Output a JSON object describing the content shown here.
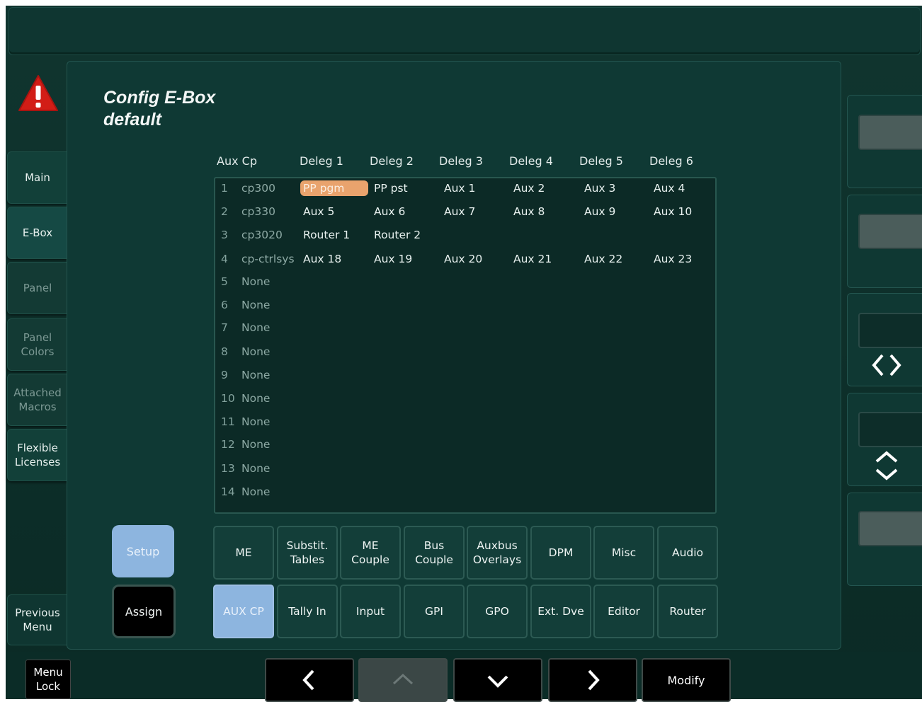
{
  "window": {
    "title_line1": "Config E-Box",
    "title_line2": "default"
  },
  "left_tabs": [
    {
      "label": "Main",
      "state": "normal"
    },
    {
      "label": "E-Box",
      "state": "active"
    },
    {
      "label": "Panel",
      "state": "dim"
    },
    {
      "label": "Panel\nColors",
      "state": "dim"
    },
    {
      "label": "Attached\nMacros",
      "state": "dim"
    },
    {
      "label": "Flexible\nLicenses",
      "state": "normal"
    }
  ],
  "previous_menu": "Previous\nMenu",
  "menu_lock": "Menu\nLock",
  "table": {
    "headers": [
      "Aux Cp",
      "Deleg 1",
      "Deleg 2",
      "Deleg 3",
      "Deleg 4",
      "Deleg 5",
      "Deleg 6"
    ],
    "rows": [
      {
        "num": "1",
        "cp": "cp300",
        "d": [
          "PP pgm",
          "PP pst",
          "Aux 1",
          "Aux 2",
          "Aux 3",
          "Aux 4"
        ]
      },
      {
        "num": "2",
        "cp": "cp330",
        "d": [
          "Aux 5",
          "Aux 6",
          "Aux 7",
          "Aux 8",
          "Aux 9",
          "Aux 10"
        ]
      },
      {
        "num": "3",
        "cp": "cp3020",
        "d": [
          "Router 1",
          "Router 2",
          "",
          "",
          "",
          ""
        ]
      },
      {
        "num": "4",
        "cp": "cp-ctrlsys",
        "d": [
          "Aux 18",
          "Aux 19",
          "Aux 20",
          "Aux 21",
          "Aux 22",
          "Aux 23"
        ]
      },
      {
        "num": "5",
        "cp": "None",
        "d": []
      },
      {
        "num": "6",
        "cp": "None",
        "d": []
      },
      {
        "num": "7",
        "cp": "None",
        "d": []
      },
      {
        "num": "8",
        "cp": "None",
        "d": []
      },
      {
        "num": "9",
        "cp": "None",
        "d": []
      },
      {
        "num": "10",
        "cp": "None",
        "d": []
      },
      {
        "num": "11",
        "cp": "None",
        "d": []
      },
      {
        "num": "12",
        "cp": "None",
        "d": []
      },
      {
        "num": "13",
        "cp": "None",
        "d": []
      },
      {
        "num": "14",
        "cp": "None",
        "d": []
      }
    ],
    "selected_cell": "PP pgm",
    "selected_color": "#e9a36d"
  },
  "mode_buttons": {
    "setup": "Setup",
    "assign": "Assign"
  },
  "button_row1": [
    "ME",
    "Substit.\nTables",
    "ME\nCouple",
    "Bus\nCouple",
    "Auxbus\nOverlays",
    "DPM",
    "Misc",
    "Audio"
  ],
  "button_row2": [
    "AUX CP",
    "Tally In",
    "Input",
    "GPI",
    "GPO",
    "Ext. Dve",
    "Editor",
    "Router"
  ],
  "active_button": "AUX CP",
  "bottom_nav": {
    "left_icon": "chevron-left-icon",
    "up_icon": "chevron-up-icon",
    "down_icon": "chevron-down-icon",
    "right_icon": "chevron-right-icon",
    "modify_label": "Modify"
  },
  "right_knobs": [
    "",
    "",
    "left-right-icon",
    "up-down-icon",
    ""
  ],
  "colors": {
    "accent_blue": "#8db5df",
    "selection_orange": "#e9a36d",
    "background": "#0f3934"
  }
}
